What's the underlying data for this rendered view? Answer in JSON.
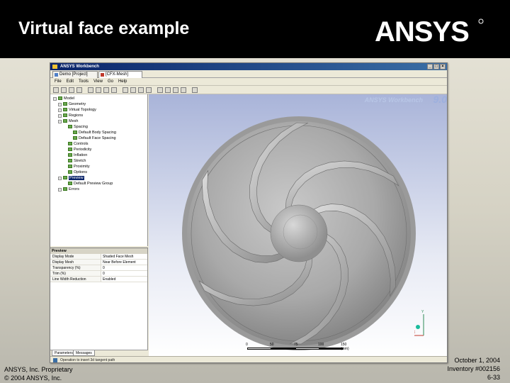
{
  "slide": {
    "title": "Virtual face example",
    "brand": "ANSYS",
    "footer_left_1": "ANSYS, Inc. Proprietary",
    "footer_left_2": "© 2004 ANSYS, Inc.",
    "footer_right_1": "October 1, 2004",
    "footer_right_2": "Inventory #002156",
    "footer_right_3": "6-33"
  },
  "app": {
    "window_title": "ANSYS Workbench",
    "tabs": [
      "Demo [Project]",
      "[CFX-Mesh]"
    ],
    "menu": [
      "File",
      "Edit",
      "Tools",
      "View",
      "Go",
      "Help"
    ],
    "watermark_product": "ANSYS Workbench",
    "watermark_version": "9.0",
    "status": "Operation to insert 3d tangent path"
  },
  "tree": {
    "items": [
      {
        "label": "Model",
        "level": 0
      },
      {
        "label": "Geometry",
        "level": 1
      },
      {
        "label": "Virtual Topology",
        "level": 1
      },
      {
        "label": "Regions",
        "level": 1
      },
      {
        "label": "Mesh",
        "level": 1
      },
      {
        "label": "Spacing",
        "level": 2
      },
      {
        "label": "Default Body Spacing",
        "level": 3
      },
      {
        "label": "Default Face Spacing",
        "level": 3
      },
      {
        "label": "Controls",
        "level": 2
      },
      {
        "label": "Periodicity",
        "level": 2
      },
      {
        "label": "Inflation",
        "level": 2
      },
      {
        "label": "Stretch",
        "level": 2
      },
      {
        "label": "Proximity",
        "level": 2
      },
      {
        "label": "Options",
        "level": 2
      },
      {
        "label": "Preview",
        "level": 1,
        "selected": true
      },
      {
        "label": "Default Preview Group",
        "level": 2
      },
      {
        "label": "Errors",
        "level": 1
      }
    ]
  },
  "details": {
    "header": "Preview",
    "rows": [
      {
        "key": "Display Mode",
        "value": "Shaded Face Mesh"
      },
      {
        "key": "Display Mesh",
        "value": "Near Before Element"
      },
      {
        "key": "Transparency (%)",
        "value": "0"
      },
      {
        "key": "Trim (%)",
        "value": "0"
      },
      {
        "key": "Line Width Reduction",
        "value": "Enabled"
      }
    ],
    "bottom_tabs": [
      "Parameters",
      "Messages"
    ]
  },
  "scale": {
    "ticks": [
      "0",
      "50",
      "75",
      "100",
      "150 (mm)"
    ]
  },
  "triad": {
    "y": "Y",
    "x": "X"
  }
}
